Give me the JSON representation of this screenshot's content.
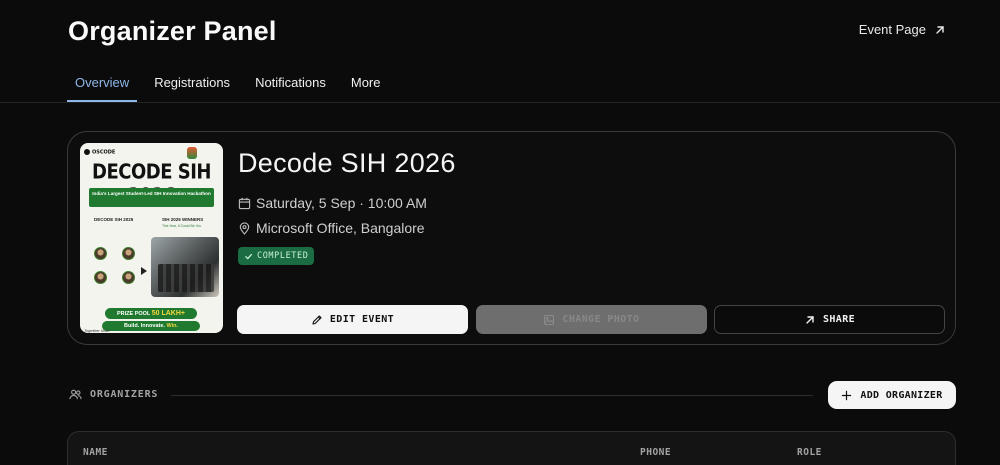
{
  "header": {
    "title": "Organizer Panel",
    "event_page_link": "Event Page"
  },
  "tabs": [
    {
      "label": "Overview",
      "active": true
    },
    {
      "label": "Registrations",
      "active": false
    },
    {
      "label": "Notifications",
      "active": false
    },
    {
      "label": "More",
      "active": false
    }
  ],
  "event": {
    "title": "Decode SIH 2026",
    "date_time": "Saturday, 5 Sep · 10:00 AM",
    "location": "Microsoft Office, Bangalore",
    "status": "COMPLETED",
    "actions": {
      "edit": "EDIT EVENT",
      "change_photo": "CHANGE PHOTO",
      "share": "SHARE"
    },
    "poster": {
      "logo": "OSCODE",
      "headline": "DECODE SIH 2026",
      "banner": "India's Largest Student-Led SIH Innovation Hackathon",
      "left_heading": "DECODE SIH 2025",
      "right_heading": "SIH 2025 WINNERS",
      "right_sub": "This Year, It Could Be You",
      "prize_label": "PRIZE POOL",
      "prize_value": "50 LAKH+",
      "slogan_prefix": "Build. Innovate.",
      "slogan_highlight": "Win.",
      "tagline": "Together Now!"
    }
  },
  "organizers": {
    "section_label": "ORGANIZERS",
    "add_button": "ADD ORGANIZER",
    "columns": [
      "NAME",
      "PHONE",
      "ROLE"
    ]
  },
  "colors": {
    "background": "#0b0b0b",
    "accent_tab": "#8db7e8",
    "status_green": "#1b6b43"
  },
  "icons": {
    "event_page": "arrow-up-right-icon",
    "date": "calendar-icon",
    "location": "map-pin-icon",
    "status": "check-icon",
    "edit": "pencil-icon",
    "photo": "image-icon",
    "share": "arrow-up-right-icon",
    "organizers": "users-icon",
    "add": "plus-icon"
  }
}
